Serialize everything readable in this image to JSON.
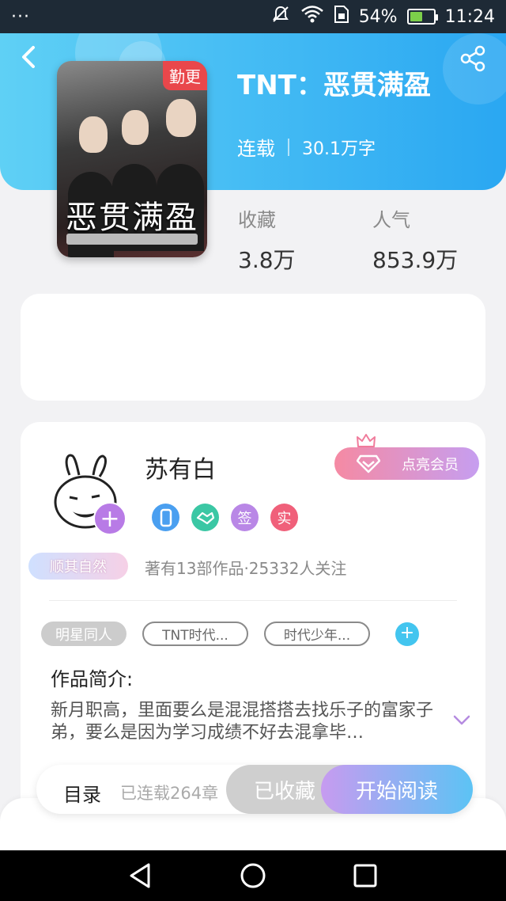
{
  "status_bar": {
    "menu_dots": "···",
    "battery_percent": "54%",
    "battery_level": 0.54,
    "time": "11:24",
    "icons": [
      "overflow-dots-icon",
      "mute-icon",
      "wifi-icon",
      "sim-icon",
      "battery-icon"
    ]
  },
  "header": {
    "back_icon": "chevron-left-icon",
    "share_icon": "share-icon",
    "title": "TNT：恶贯满盈",
    "status": "连载",
    "word_count": "30.1万字",
    "gradient": [
      "#5fd0f5",
      "#2aa7f2"
    ]
  },
  "cover": {
    "badge": "勤更",
    "title_art": "恶贯满盈",
    "badge_color": "#e9474b"
  },
  "stats": {
    "collect_label": "收藏",
    "collect_value": "3.8万",
    "popularity_label": "人气",
    "popularity_value": "853.9万"
  },
  "author": {
    "name": "苏有白",
    "vip_button": "点亮会员",
    "follow_icon": "plus-icon",
    "badges": [
      {
        "icon": "phone-badge-icon",
        "text": "",
        "color": "#4a9ff0"
      },
      {
        "icon": "handshake-badge-icon",
        "text": "",
        "color": "#3bc7a4"
      },
      {
        "icon": "sign-badge-icon",
        "text": "签",
        "color": "#b987e6"
      },
      {
        "icon": "verified-badge-icon",
        "text": "实",
        "color": "#f0607a"
      }
    ],
    "motto": "顺其自然",
    "meta": "著有13部作品·25332人关注"
  },
  "tags": {
    "items": [
      {
        "label": "明星同人",
        "style": "filled"
      },
      {
        "label": "TNT时代...",
        "style": "outline"
      },
      {
        "label": "时代少年...",
        "style": "outline"
      }
    ],
    "add_icon": "plus-icon"
  },
  "intro": {
    "title": "作品简介:",
    "text": "新月职高，里面要么是混混搭搭去找乐子的富家子弟，要么是因为学习成绩不好去混拿毕…",
    "expand_icon": "chevron-down-icon"
  },
  "bottom_bar": {
    "toc_label": "目录",
    "toc_count": "已连载264章",
    "collected_button": "已收藏",
    "read_button": "开始阅读"
  },
  "nav_bar": {
    "icons": [
      "back-triangle-icon",
      "home-circle-icon",
      "recents-square-icon"
    ]
  }
}
